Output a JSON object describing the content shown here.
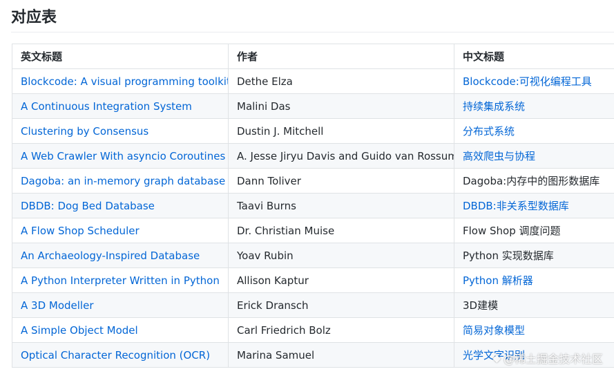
{
  "title": "对应表",
  "table": {
    "headers": [
      "英文标题",
      "作者",
      "中文标题"
    ],
    "rows": [
      {
        "en": "Blockcode: A visual programming toolkit",
        "author": "Dethe Elza",
        "zh": "Blockcode:可视化编程工具",
        "en_link": true,
        "zh_link": true
      },
      {
        "en": "A Continuous Integration System",
        "author": "Malini Das",
        "zh": "持续集成系统",
        "en_link": true,
        "zh_link": true
      },
      {
        "en": "Clustering by Consensus",
        "author": "Dustin J. Mitchell",
        "zh": "分布式系统",
        "en_link": true,
        "zh_link": true
      },
      {
        "en": "A Web Crawler With asyncio Coroutines",
        "author": "A. Jesse Jiryu Davis and Guido van Rossum",
        "zh": "高效爬虫与协程",
        "en_link": true,
        "zh_link": true
      },
      {
        "en": "Dagoba: an in-memory graph database",
        "author": "Dann Toliver",
        "zh": "Dagoba:内存中的图形数据库",
        "en_link": true,
        "zh_link": false
      },
      {
        "en": "DBDB: Dog Bed Database",
        "author": "Taavi Burns",
        "zh": "DBDB:非关系型数据库",
        "en_link": true,
        "zh_link": true
      },
      {
        "en": "A Flow Shop Scheduler",
        "author": "Dr. Christian Muise",
        "zh": "Flow Shop 调度问题",
        "en_link": true,
        "zh_link": false
      },
      {
        "en": "An Archaeology-Inspired Database",
        "author": "Yoav Rubin",
        "zh": "Python 实现数据库",
        "en_link": true,
        "zh_link": false
      },
      {
        "en": "A Python Interpreter Written in Python",
        "author": "Allison Kaptur",
        "zh": "Python 解析器",
        "en_link": true,
        "zh_link": true
      },
      {
        "en": "A 3D Modeller",
        "author": "Erick Dransch",
        "zh": "3D建模",
        "en_link": true,
        "zh_link": false
      },
      {
        "en": "A Simple Object Model",
        "author": "Carl Friedrich Bolz",
        "zh": "简易对象模型",
        "en_link": true,
        "zh_link": true
      },
      {
        "en": "Optical Character Recognition (OCR)",
        "author": "Marina Samuel",
        "zh": "光学文字识别",
        "en_link": true,
        "zh_link": true
      }
    ]
  },
  "watermark": {
    "text": "@稀土掘金技术社区",
    "icon": "juejin-logo-icon"
  },
  "colors": {
    "link": "#0366d6",
    "border": "#dfe2e5",
    "stripe": "#f6f8fa"
  }
}
